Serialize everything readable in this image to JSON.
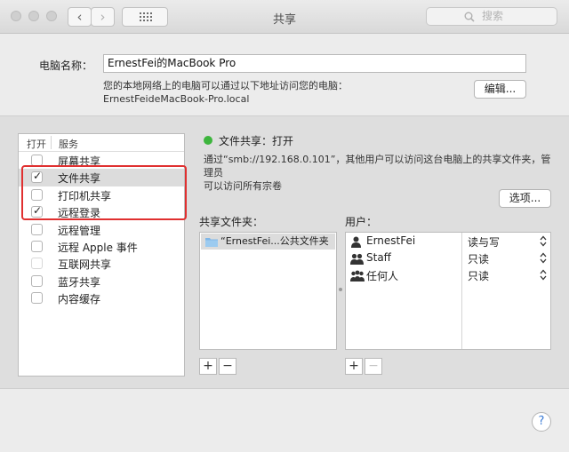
{
  "window": {
    "title": "共享"
  },
  "toolbar": {
    "search_placeholder": "搜索",
    "back_glyph": "‹",
    "forward_glyph": "›"
  },
  "computer_name": {
    "label": "电脑名称：",
    "value": "ErnestFei的MacBook Pro",
    "help_line1": "您的本地网络上的电脑可以通过以下地址访问您的电脑：",
    "help_line2": "ErnestFeideMacBook-Pro.local",
    "edit_button": "编辑..."
  },
  "services": {
    "header_on": "打开",
    "header_service": "服务",
    "items": [
      {
        "label": "屏幕共享",
        "checked": false,
        "selected": false
      },
      {
        "label": "文件共享",
        "checked": true,
        "selected": true
      },
      {
        "label": "打印机共享",
        "checked": false,
        "selected": false
      },
      {
        "label": "远程登录",
        "checked": true,
        "selected": false
      },
      {
        "label": "远程管理",
        "checked": false,
        "selected": false
      },
      {
        "label": "远程 Apple 事件",
        "checked": false,
        "selected": false
      },
      {
        "label": "互联网共享",
        "checked": false,
        "selected": false
      },
      {
        "label": "蓝牙共享",
        "checked": false,
        "selected": false
      },
      {
        "label": "内容缓存",
        "checked": false,
        "selected": false
      }
    ]
  },
  "detail": {
    "status": "文件共享：打开",
    "status_color": "#3db53d",
    "desc_line1": "通过“smb://192.168.0.101”，其他用户可以访问这台电脑上的共享文件夹，管理员",
    "desc_line2": "可以访问所有宗卷",
    "options_button": "选项...",
    "folders_label": "共享文件夹：",
    "users_label": "用户：",
    "folders": [
      {
        "name": "“ErnestFei...公共文件夹"
      }
    ],
    "users": [
      {
        "name": "ErnestFei",
        "permission": "读与写",
        "icon": "single-user-icon"
      },
      {
        "name": "Staff",
        "permission": "只读",
        "icon": "group-icon"
      },
      {
        "name": "任何人",
        "permission": "只读",
        "icon": "everyone-icon"
      }
    ],
    "plus": "+",
    "minus": "−"
  },
  "help_button": "?",
  "highlight_color": "#e03030"
}
